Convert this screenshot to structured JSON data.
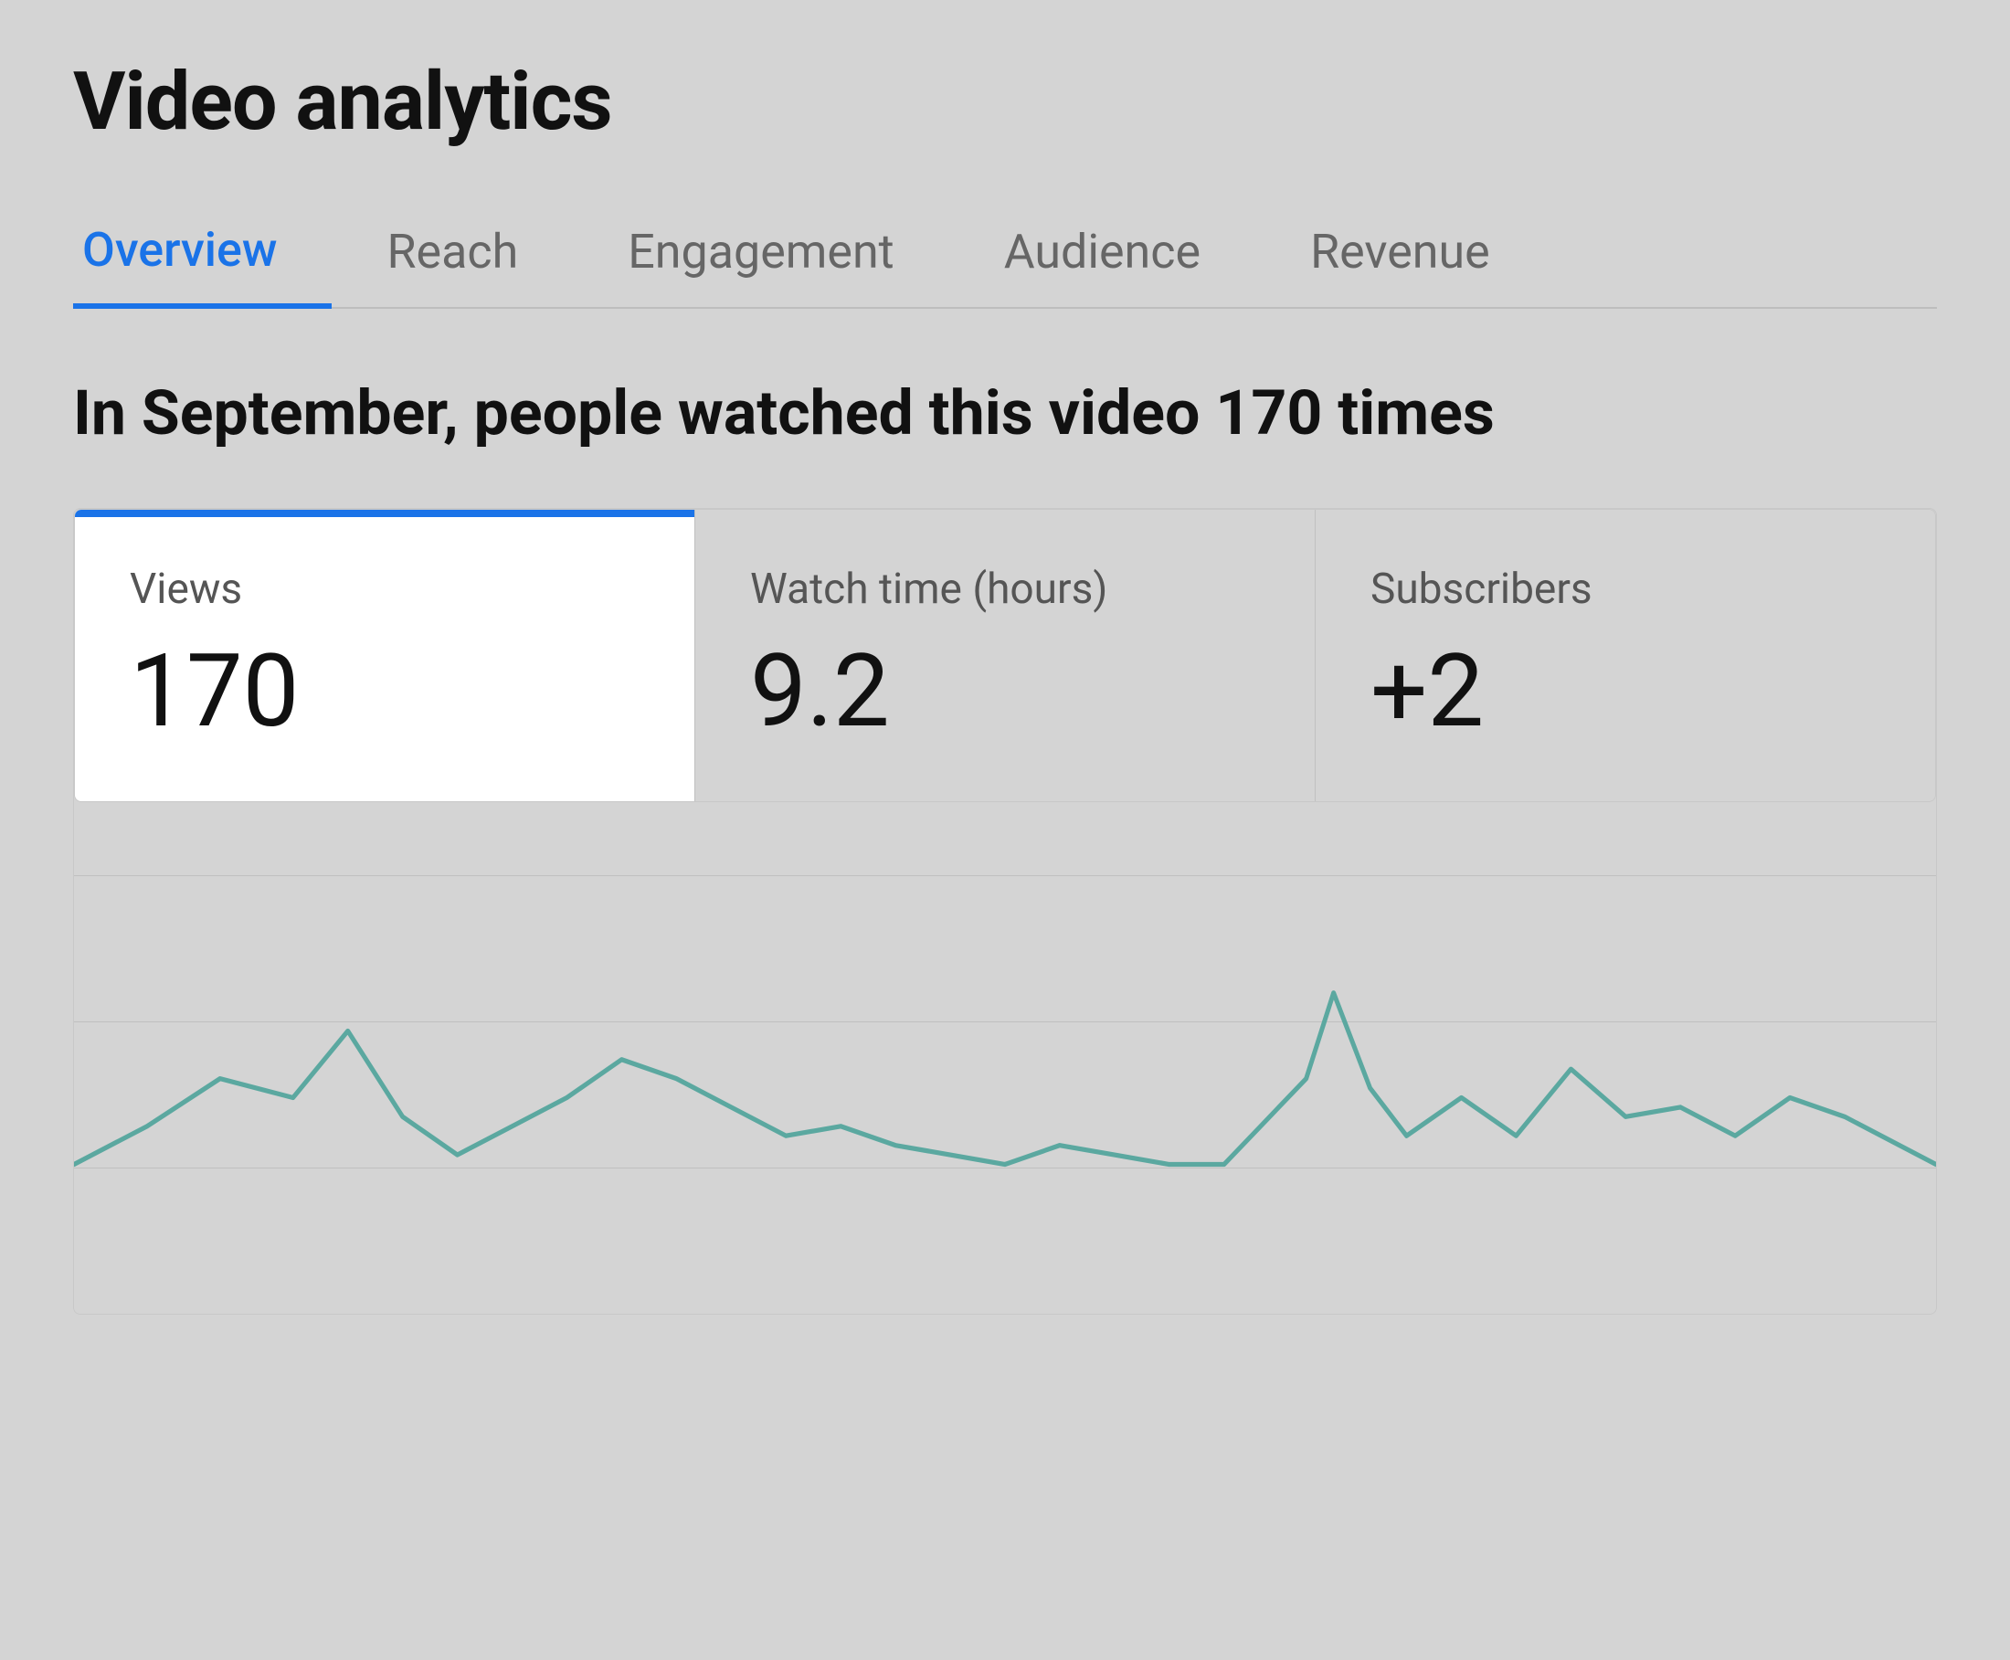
{
  "page": {
    "title": "Video analytics"
  },
  "tabs": {
    "items": [
      {
        "label": "Overview",
        "active": true
      },
      {
        "label": "Reach",
        "active": false
      },
      {
        "label": "Engagement",
        "active": false
      },
      {
        "label": "Audience",
        "active": false
      },
      {
        "label": "Revenue",
        "active": false
      }
    ]
  },
  "summary": {
    "heading": "In September, people watched this video 170 times"
  },
  "metrics": {
    "views": {
      "label": "Views",
      "value": "170",
      "active": true
    },
    "watch_time": {
      "label": "Watch time (hours)",
      "value": "9.2"
    },
    "subscribers": {
      "label": "Subscribers",
      "value": "+2"
    }
  },
  "chart": {
    "color": "#5ba8a0",
    "grid_lines": 3
  },
  "colors": {
    "accent_blue": "#1a73e8",
    "chart_teal": "#5ba8a0",
    "bg": "#d4d4d4",
    "active_tab_underline": "#1a73e8"
  }
}
